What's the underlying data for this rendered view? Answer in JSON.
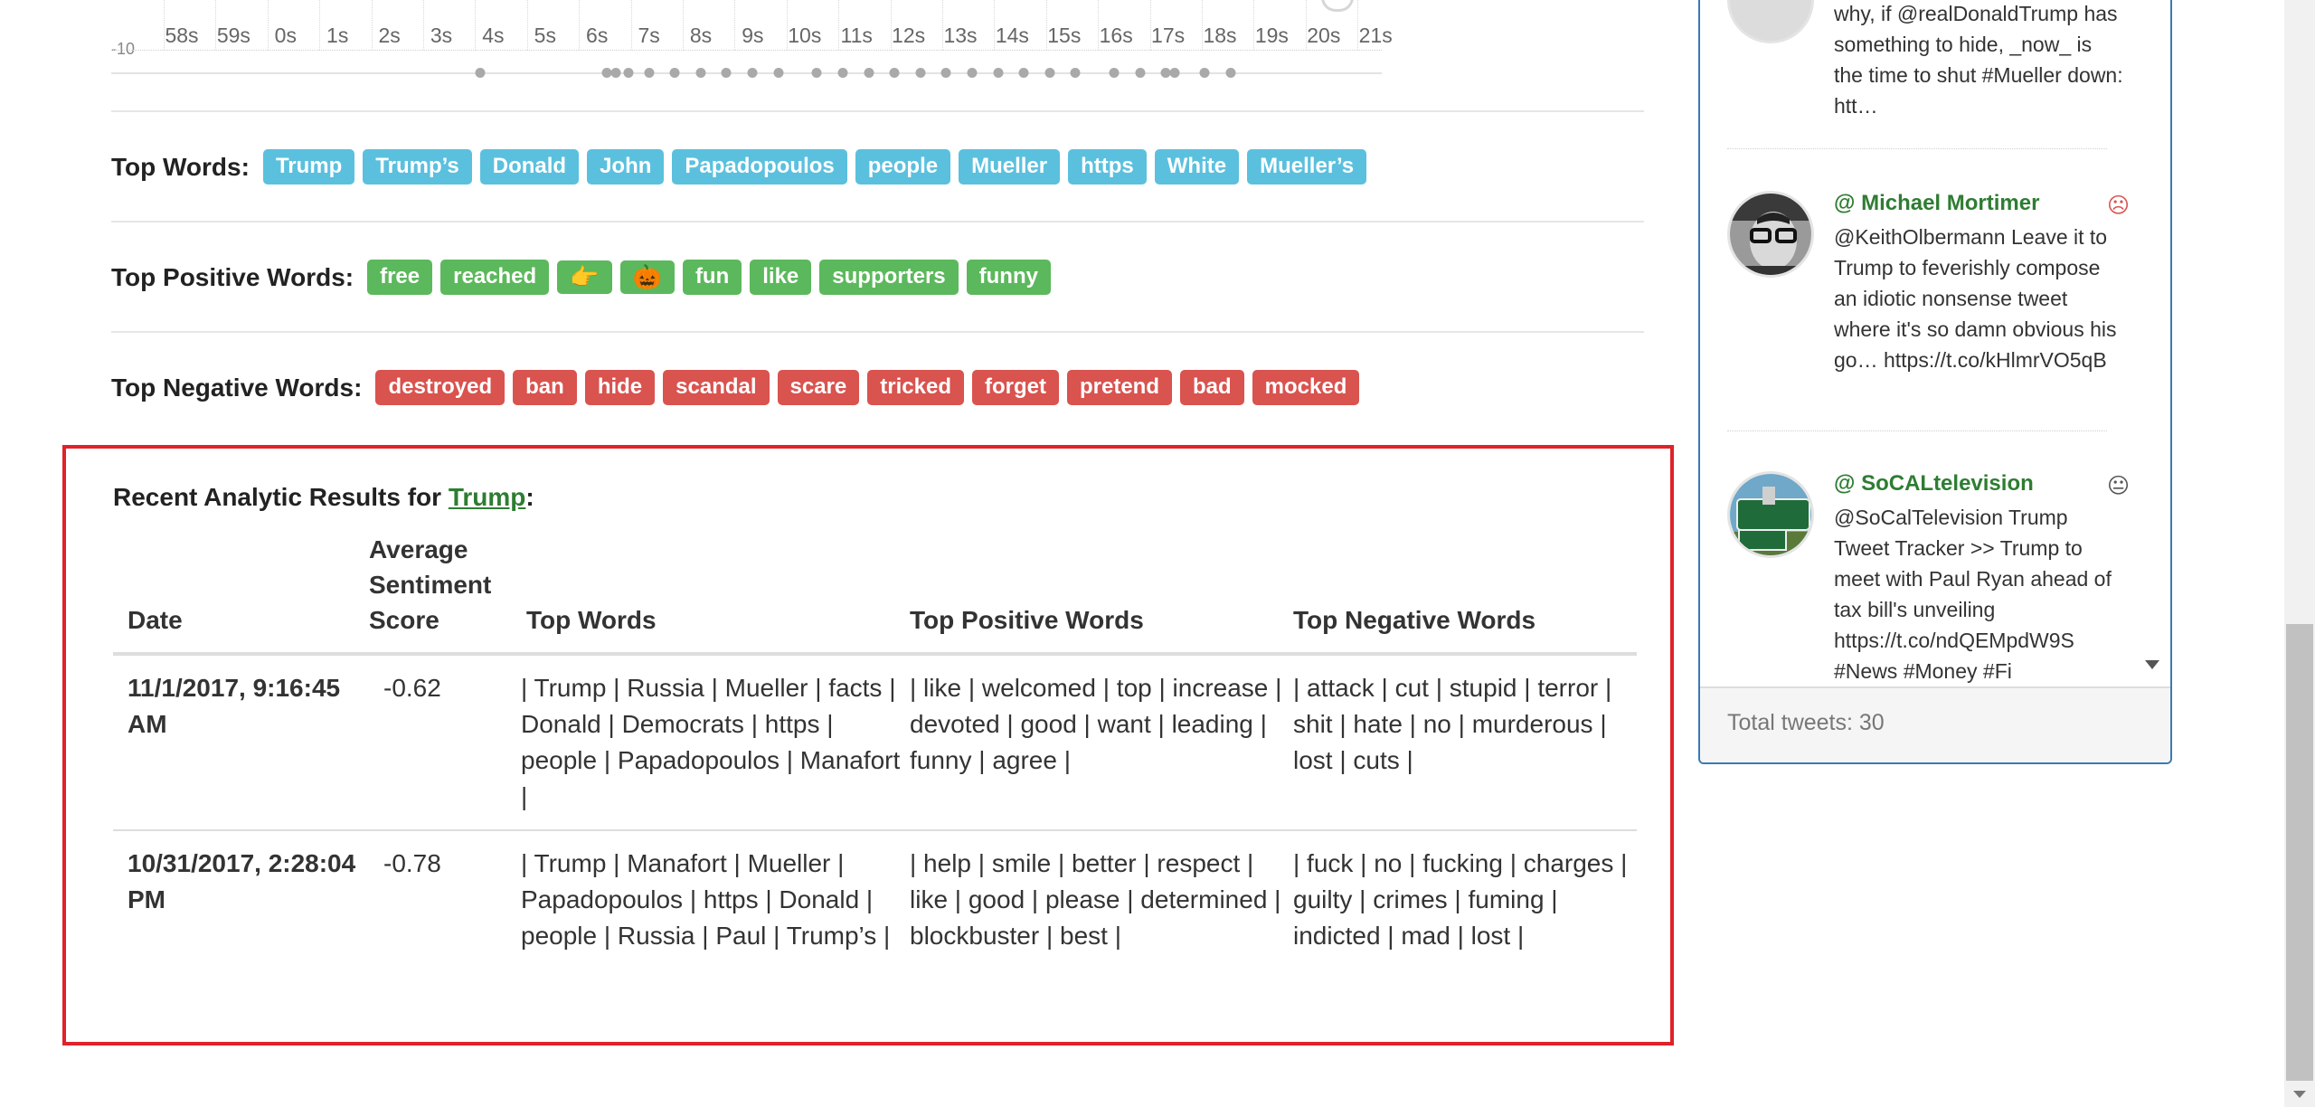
{
  "timeline": {
    "y_label": "-10",
    "ticks": [
      "58s",
      "59s",
      "0s",
      "1s",
      "2s",
      "3s",
      "4s",
      "5s",
      "6s",
      "7s",
      "8s",
      "9s",
      "10s",
      "11s",
      "12s",
      "13s",
      "14s",
      "15s",
      "16s",
      "17s",
      "18s",
      "19s",
      "20s",
      "21s"
    ]
  },
  "top_words": {
    "title": "Top Words:",
    "items": [
      "Trump",
      "Trump’s",
      "Donald",
      "John",
      "Papadopoulos",
      "people",
      "Mueller",
      "https",
      "White",
      "Mueller’s"
    ]
  },
  "top_positive_words": {
    "title": "Top Positive Words:",
    "items": [
      "free",
      "reached",
      "👉",
      "🎃",
      "fun",
      "like",
      "supporters",
      "funny"
    ]
  },
  "top_negative_words": {
    "title": "Top Negative Words:",
    "items": [
      "destroyed",
      "ban",
      "hide",
      "scandal",
      "scare",
      "tricked",
      "forget",
      "pretend",
      "bad",
      "mocked"
    ]
  },
  "results": {
    "title_prefix": "Recent Analytic Results for ",
    "title_link": "Trump",
    "title_suffix": ":",
    "headers": {
      "date": "Date",
      "score_line1": "Average",
      "score_line2": "Sentiment",
      "score_line3": "Score",
      "words": "Top Words",
      "positive": "Top Positive Words",
      "negative": "Top Negative Words"
    },
    "rows": [
      {
        "date": "11/1/2017, 9:16:45 AM",
        "score": "-0.62",
        "words": "| Trump | Russia | Mueller | facts | Donald | Democrats | https | people | Papadopoulos | Manafort |",
        "positive": "| like | welcomed | top | increase | devoted | good | want | leading | funny | agree |",
        "negative": "| attack | cut | stupid | terror | shit | hate | no | murderous | lost | cuts |"
      },
      {
        "date": "10/31/2017, 2:28:04 PM",
        "score": "-0.78",
        "words": "| Trump | Manafort | Mueller | Papadopoulos | https | Donald | people | Russia | Paul | Trump’s |",
        "positive": "| help | smile | better | respect | like | good | please | determined | blockbuster | best |",
        "negative": "| fuck | no | fucking | charges | guilty | crimes | fuming | indicted | mad | lost |"
      }
    ]
  },
  "tweets": [
    {
      "user": "",
      "mood": "",
      "text": "why, if @realDonaldTrump has something to hide, _now_ is the time to shut #Mueller down: htt…"
    },
    {
      "user": "@ Michael Mortimer",
      "mood": "☹",
      "mood_color": "#d9534f",
      "text": "@KeithOlbermann Leave it to Trump to feverishly compose an idiotic nonsense tweet where it's so damn obvious his go… https://t.co/kHlmrVO5qB"
    },
    {
      "user": "@ SoCALtelevision",
      "mood": "😐",
      "mood_color": "#555555",
      "text": "@SoCalTelevision Trump Tweet Tracker >> Trump to meet with Paul Ryan ahead of tax bill's unveiling https://t.co/ndQEMpdW9S #News #Money #Fi"
    }
  ],
  "total_tweets": "Total tweets: 30",
  "colors": {
    "info": "#5bc0de",
    "positive": "#5cb85c",
    "negative": "#d9534f",
    "highlight_border": "#e0222a",
    "username": "#2e7d32"
  }
}
